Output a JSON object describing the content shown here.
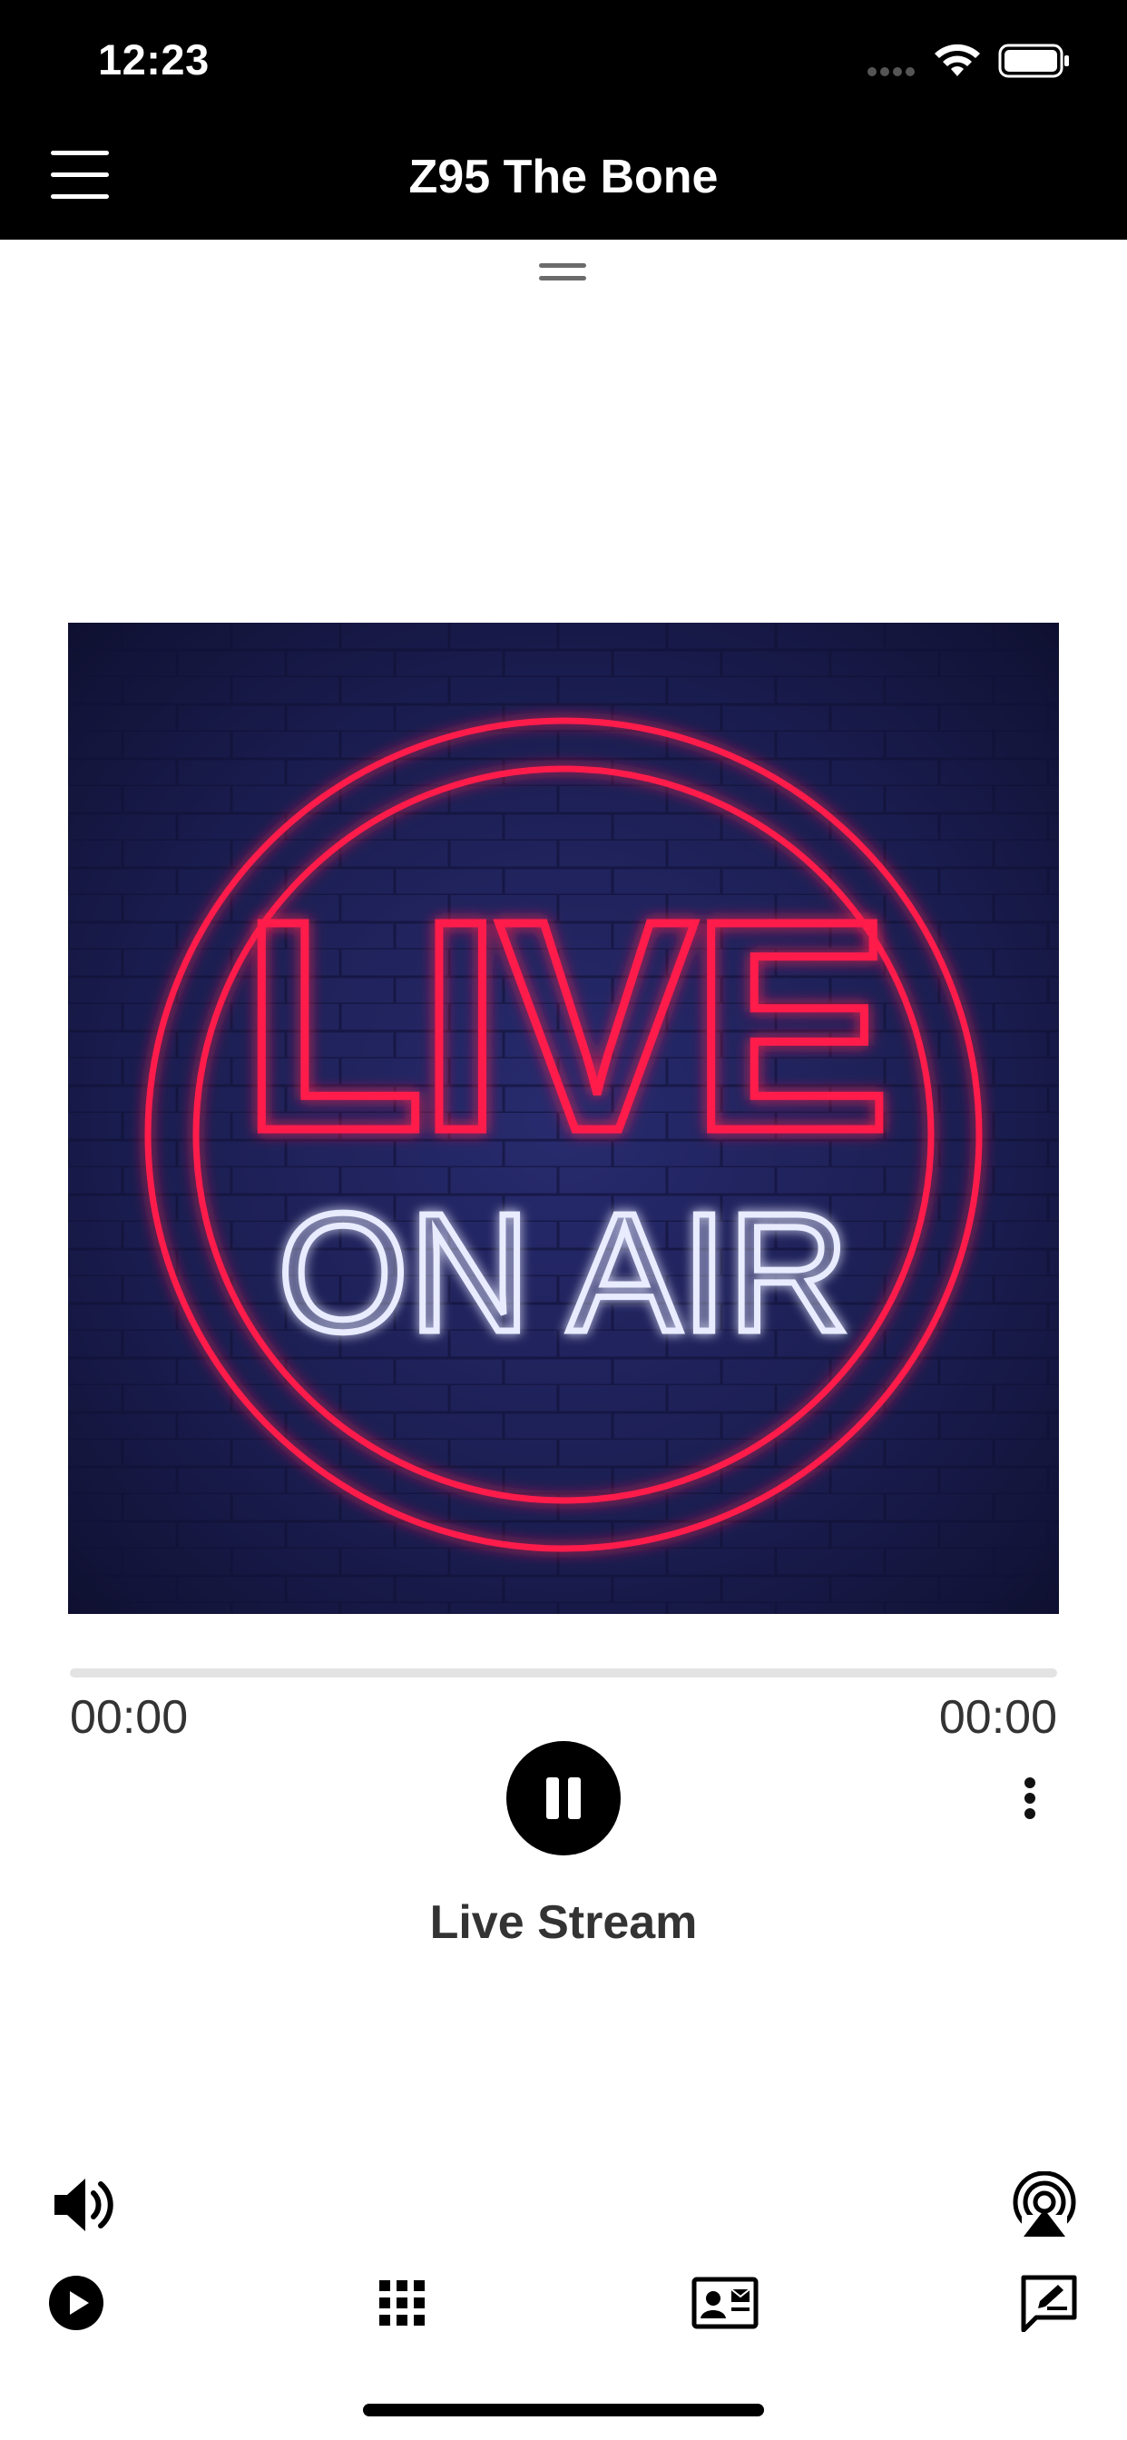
{
  "status_bar": {
    "time": "12:23"
  },
  "header": {
    "title": "Z95 The Bone"
  },
  "artwork": {
    "line1": "LIVE",
    "line2": "ON AIR"
  },
  "player": {
    "elapsed": "00:00",
    "duration": "00:00",
    "progress": 0,
    "stream_name": "Live Stream"
  },
  "icons": {
    "menu": "hamburger-menu-icon",
    "grabber": "grabber-handle-icon",
    "pause": "pause-icon",
    "more": "more-vertical-icon",
    "volume": "volume-icon",
    "airplay": "airplay-icon",
    "play": "play-icon",
    "grid": "grid-icon",
    "contact": "contact-card-icon",
    "message": "message-edit-icon"
  },
  "colors": {
    "header_bg": "#000000",
    "neon_red": "#ff1f4b",
    "neon_white": "#e9ecff",
    "brick_bg": "#1b1b4a"
  }
}
